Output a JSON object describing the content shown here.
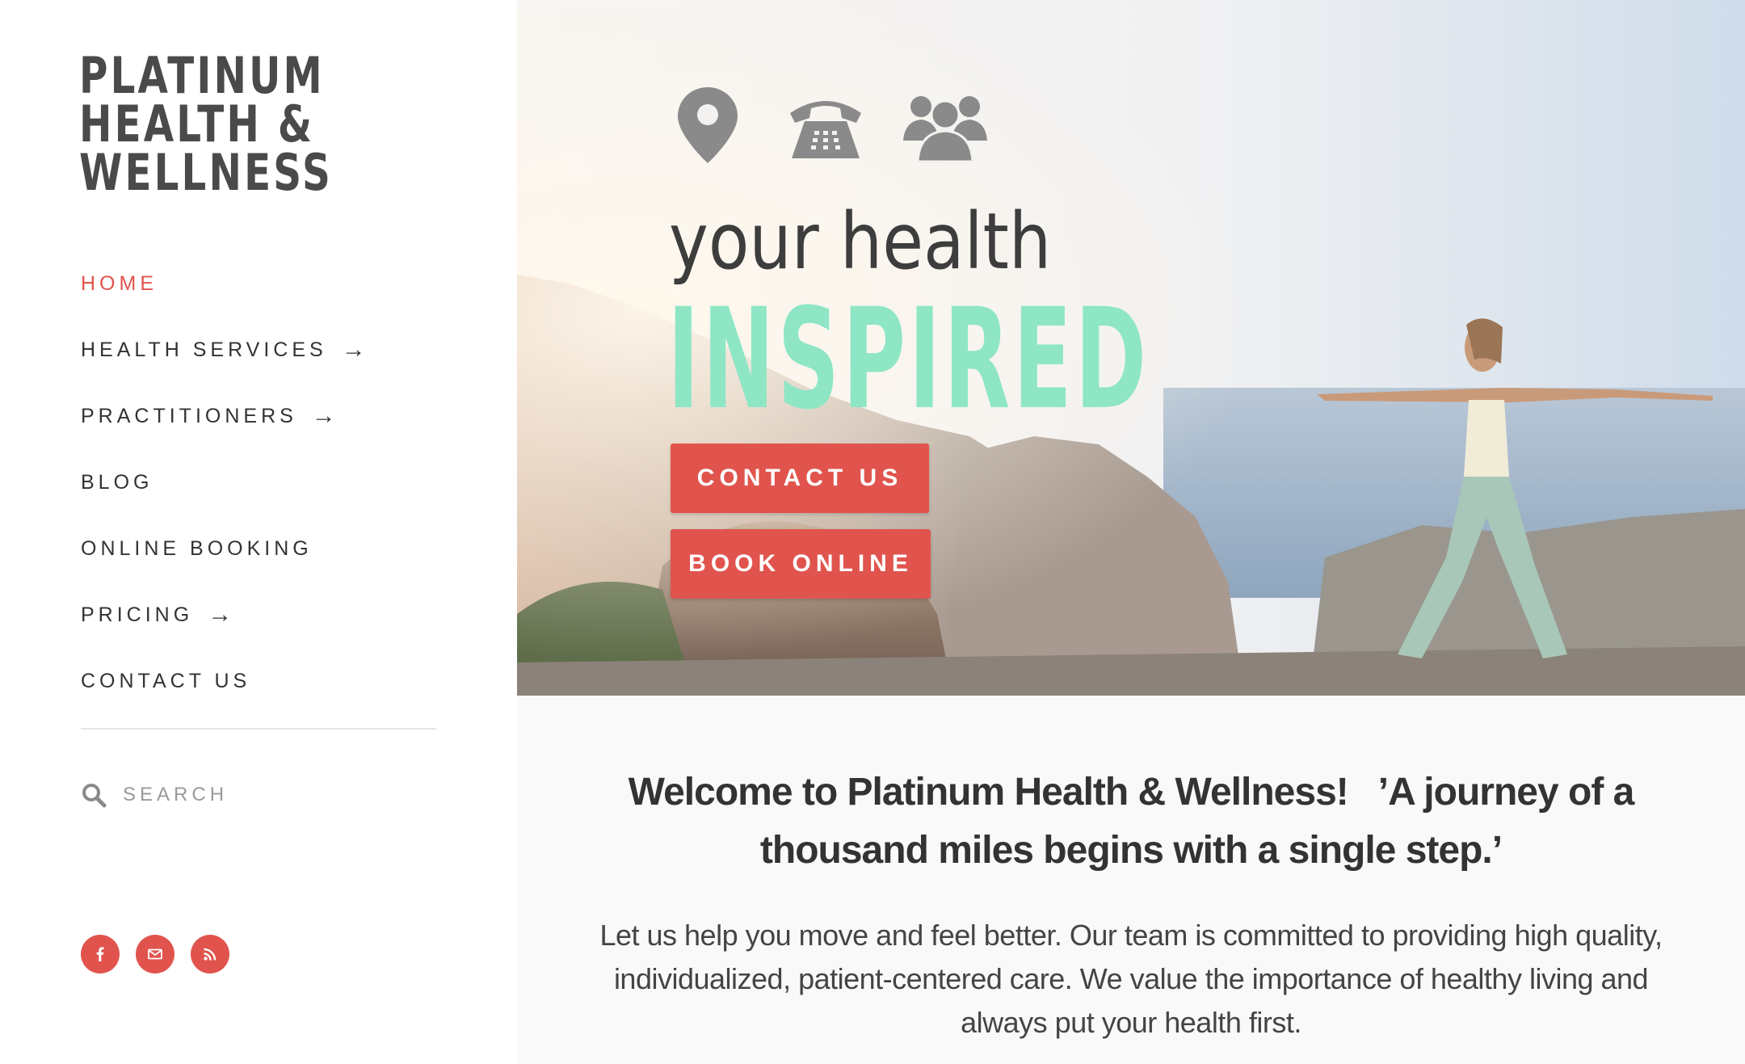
{
  "site": {
    "logo_lines": [
      "PLATINUM",
      "HEALTH &",
      "WELLNESS"
    ]
  },
  "nav": {
    "items": [
      {
        "label": "HOME",
        "active": true,
        "has_submenu": false
      },
      {
        "label": "HEALTH SERVICES",
        "active": false,
        "has_submenu": true
      },
      {
        "label": "PRACTITIONERS",
        "active": false,
        "has_submenu": true
      },
      {
        "label": "BLOG",
        "active": false,
        "has_submenu": false
      },
      {
        "label": "ONLINE BOOKING",
        "active": false,
        "has_submenu": false
      },
      {
        "label": "PRICING",
        "active": false,
        "has_submenu": true
      },
      {
        "label": "CONTACT US",
        "active": false,
        "has_submenu": false
      }
    ],
    "submenu_arrow": "→"
  },
  "search": {
    "placeholder": "SEARCH",
    "icon": "search-icon"
  },
  "social": [
    {
      "name": "facebook",
      "icon": "facebook-icon"
    },
    {
      "name": "email",
      "icon": "mail-icon"
    },
    {
      "name": "rss",
      "icon": "rss-icon"
    }
  ],
  "hero": {
    "icons": [
      "map-pin-icon",
      "telephone-icon",
      "group-icon"
    ],
    "tagline": "your health",
    "title": "INSPIRED",
    "contact_button": "CONTACT US",
    "book_button": "BOOK ONLINE"
  },
  "content": {
    "welcome_heading": "Welcome to Platinum Health & Wellness!   ’A journey of a thousand miles begins with a single step.’",
    "intro": "Let us help you move and feel better. Our team is committed to providing high quality, individualized, patient-centered care. We value the importance of healthy living and always put your health first."
  },
  "colors": {
    "accent": "#e0544d",
    "mint": "#8ee6c5",
    "text_dark": "#333333",
    "logo": "#4a4a4a",
    "icon_gray": "#8a8a8a",
    "content_bg": "#f9f9f9"
  }
}
